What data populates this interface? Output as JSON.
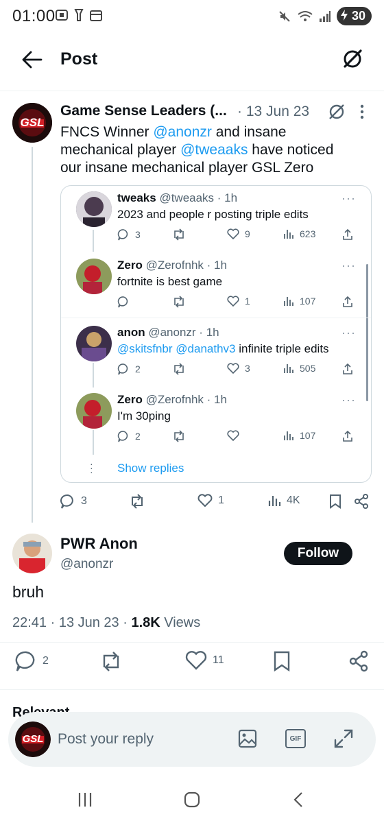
{
  "status_bar": {
    "time": "01:00",
    "battery": "30"
  },
  "header": {
    "title": "Post"
  },
  "main_post": {
    "author": "Game Sense Leaders (...",
    "date": "· 13 Jun 23",
    "avatar_text": "GSL",
    "text_line1_prefix": "FNCS Winner ",
    "text_line1_mention": "@anonzr",
    "text_line1_suffix": " and insane",
    "text_line2_prefix": "mechanical player ",
    "text_line2_mention": "@tweaaks",
    "text_line2_suffix": " have noticed",
    "text_line3": "our insane mechanical player GSL Zero",
    "actions": {
      "replies": "3",
      "likes": "1",
      "views": "4K"
    }
  },
  "quoted_thread": [
    {
      "name": "tweaks",
      "handle": "@tweaaks · 1h",
      "text": "2023 and people r posting triple edits",
      "replies": "3",
      "likes": "9",
      "views": "623"
    },
    {
      "name": "Zero",
      "handle": "@Zerofnhk · 1h",
      "text": "fortnite is best game",
      "replies": "",
      "likes": "1",
      "views": "107"
    },
    {
      "name": "anon",
      "handle": "@anonzr · 1h",
      "text_mentions": "@skitsfnbr @danathv3",
      "text": " infinite triple edits",
      "replies": "2",
      "likes": "3",
      "views": "505"
    },
    {
      "name": "Zero",
      "handle": "@Zerofnhk · 1h",
      "text": "I'm 30ping",
      "replies": "2",
      "likes": "",
      "views": "107"
    }
  ],
  "show_replies": "Show replies",
  "reply_post": {
    "author": "PWR Anon",
    "handle": "@anonzr",
    "follow_label": "Follow",
    "text": "bruh",
    "time": "22:41 · 13 Jun 23 · ",
    "views_count": "1.8K",
    "views_label": " Views",
    "actions": {
      "replies": "2",
      "likes": "11"
    }
  },
  "relevant_partial": "Relevant",
  "reply_input": {
    "placeholder": "Post your reply",
    "gif_label": "GIF"
  },
  "colors": {
    "link": "#1d9bf0",
    "muted": "#536471",
    "follow_bg": "#0f1419"
  }
}
